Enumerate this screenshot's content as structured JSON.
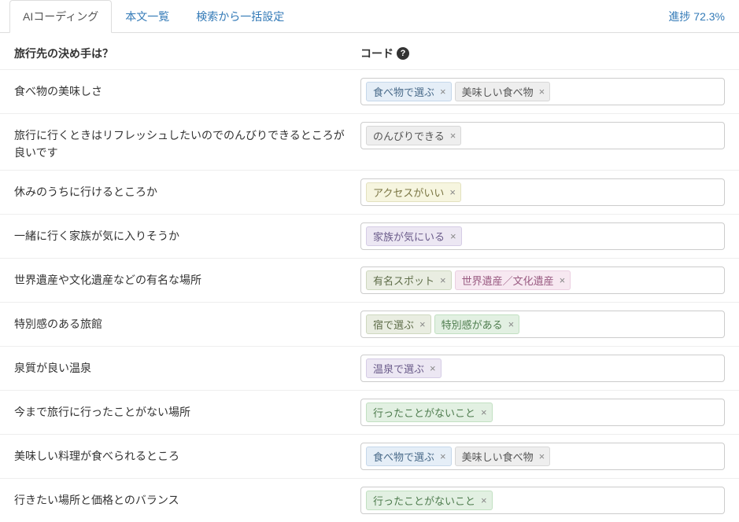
{
  "tabs": {
    "ai_coding": "AIコーディング",
    "list": "本文一覧",
    "bulk": "検索から一括設定"
  },
  "progress": {
    "label": "進捗 72.3%"
  },
  "header": {
    "question": "旅行先の決め手は？",
    "code_label": "コード",
    "help_glyph": "?"
  },
  "tag_colors": {
    "food_select": "c-blue",
    "delicious_food": "c-gray",
    "relax": "c-gray",
    "access_good": "c-yellow",
    "family_like": "c-purple",
    "famous_spot": "c-olive",
    "world_heritage": "c-pink",
    "lodging_select": "c-olive",
    "special_feel": "c-green",
    "onsen_select": "c-purple",
    "never_been": "c-green"
  },
  "tag_labels": {
    "food_select": "食べ物で選ぶ",
    "delicious_food": "美味しい食べ物",
    "relax": "のんびりできる",
    "access_good": "アクセスがいい",
    "family_like": "家族が気にいる",
    "famous_spot": "有名スポット",
    "world_heritage": "世界遺産／文化遺産",
    "lodging_select": "宿で選ぶ",
    "special_feel": "特別感がある",
    "onsen_select": "温泉で選ぶ",
    "never_been": "行ったことがないこと"
  },
  "rows": [
    {
      "text": "食べ物の美味しさ",
      "tags": [
        "food_select",
        "delicious_food"
      ]
    },
    {
      "text": "旅行に行くときはリフレッシュしたいのでのんびりできるところが良いです",
      "tags": [
        "relax"
      ]
    },
    {
      "text": "休みのうちに行けるところか",
      "tags": [
        "access_good"
      ]
    },
    {
      "text": "一緒に行く家族が気に入りそうか",
      "tags": [
        "family_like"
      ]
    },
    {
      "text": "世界遺産や文化遺産などの有名な場所",
      "tags": [
        "famous_spot",
        "world_heritage"
      ]
    },
    {
      "text": "特別感のある旅館",
      "tags": [
        "lodging_select",
        "special_feel"
      ]
    },
    {
      "text": "泉質が良い温泉",
      "tags": [
        "onsen_select"
      ]
    },
    {
      "text": "今まで旅行に行ったことがない場所",
      "tags": [
        "never_been"
      ]
    },
    {
      "text": "美味しい料理が食べられるところ",
      "tags": [
        "food_select",
        "delicious_food"
      ]
    },
    {
      "text": "行きたい場所と価格とのバランス",
      "tags": [
        "never_been"
      ]
    }
  ]
}
